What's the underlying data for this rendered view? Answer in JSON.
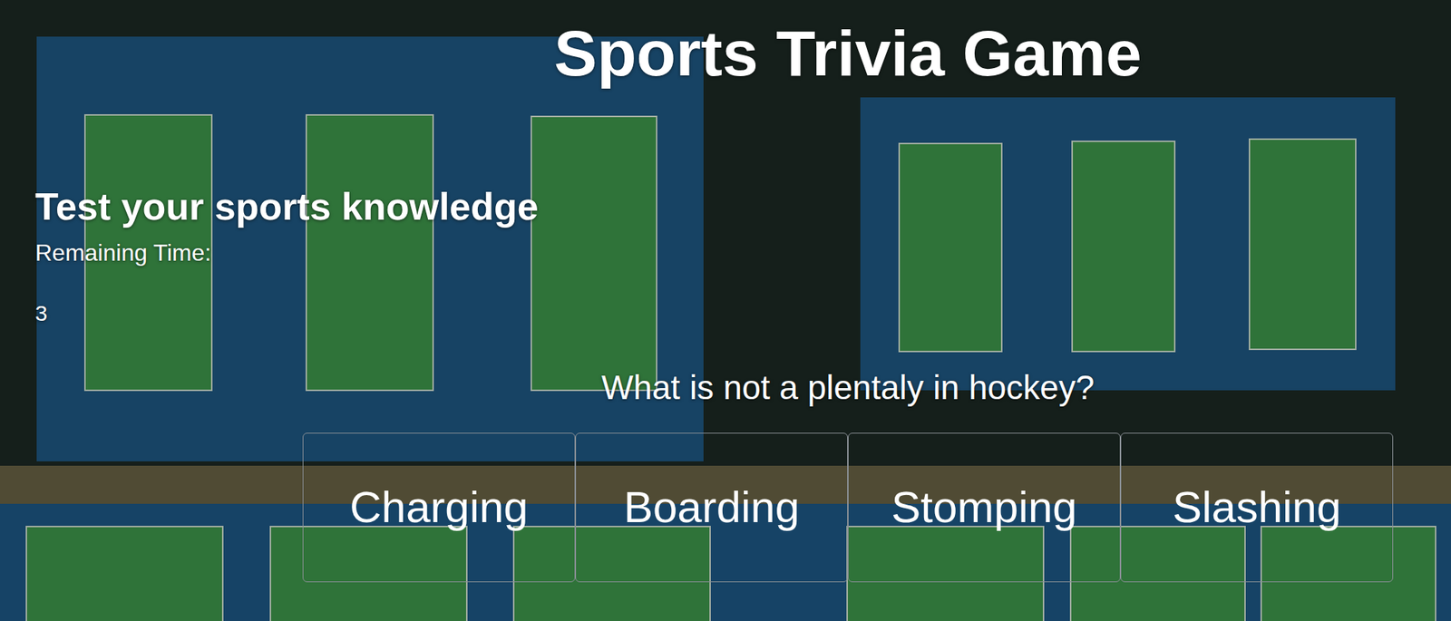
{
  "header": {
    "title": "Sports Trivia Game",
    "subtitle": "Test your sports knowledge"
  },
  "timer": {
    "label": "Remaining Time:",
    "value": "3"
  },
  "question": {
    "text": "What is not a plentaly in hockey?",
    "options": [
      "Charging",
      "Boarding",
      "Stomping",
      "Slashing"
    ]
  }
}
